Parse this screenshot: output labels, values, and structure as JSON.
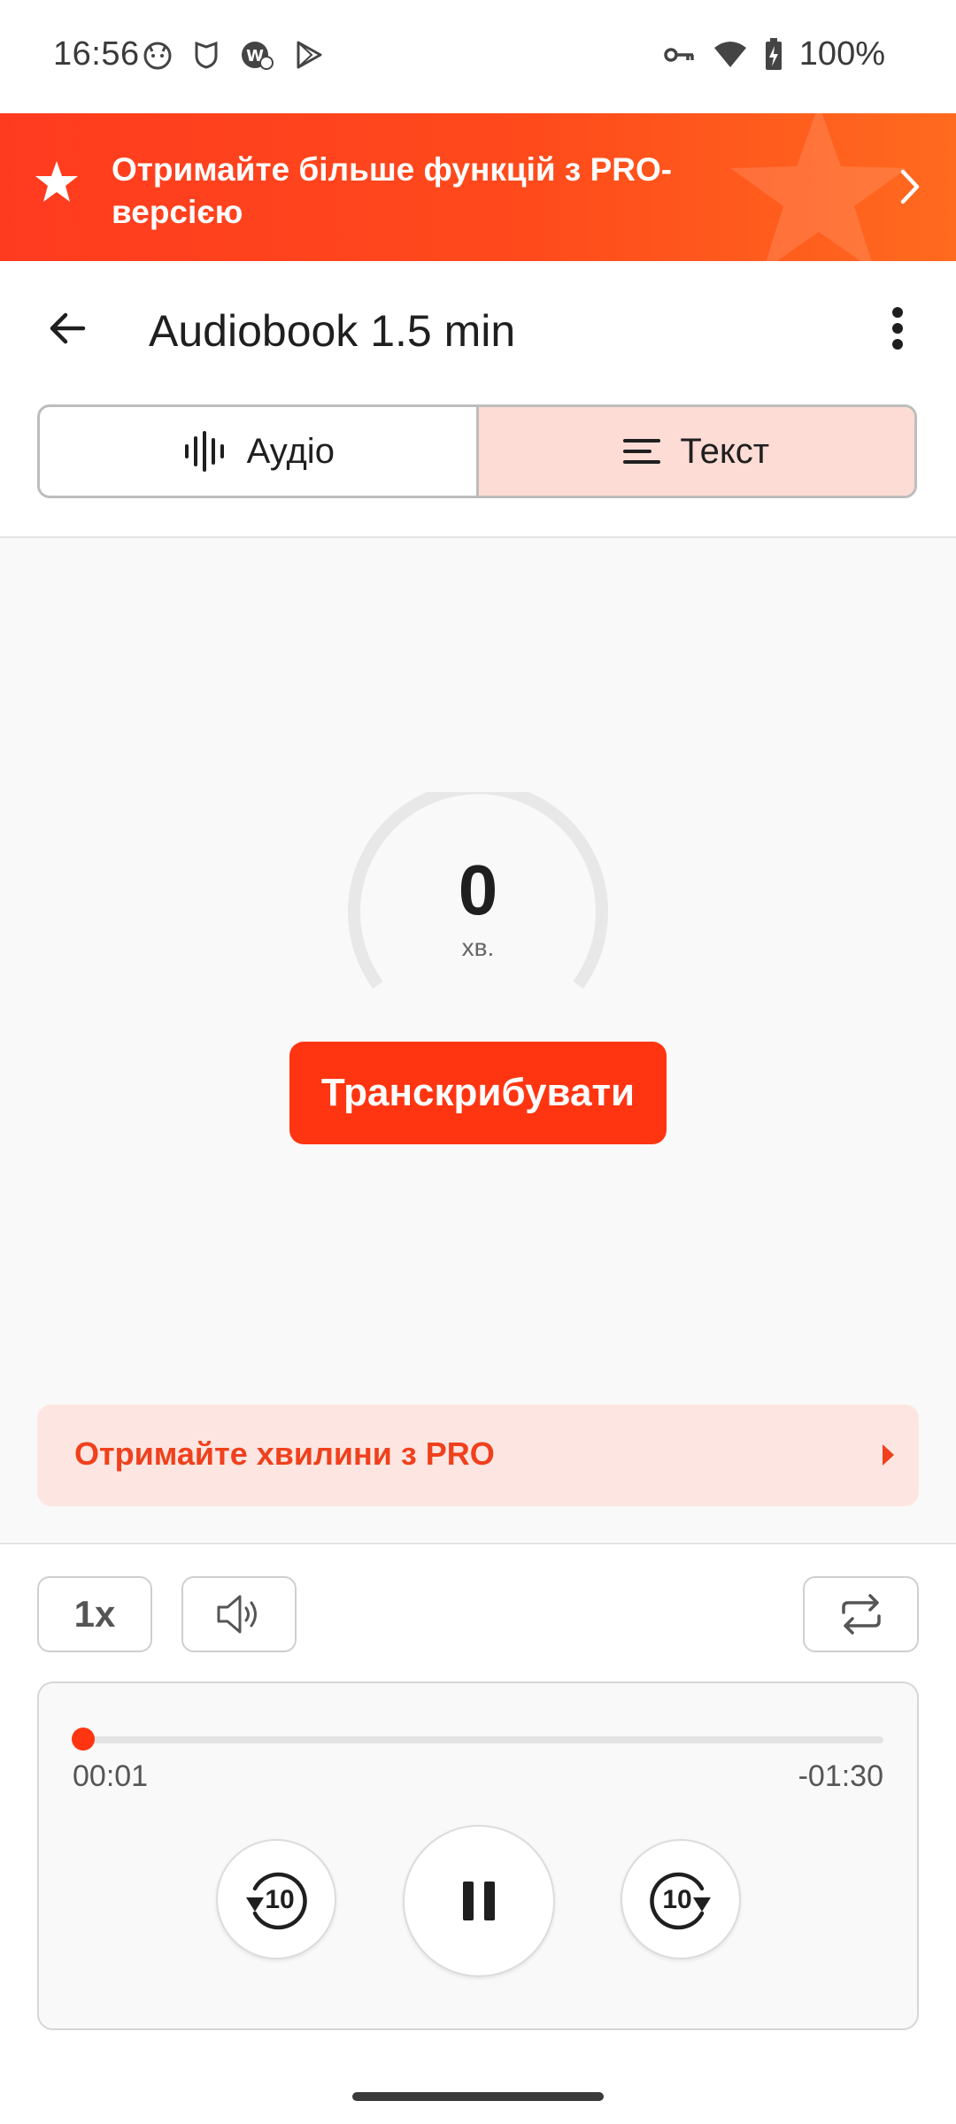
{
  "status_bar": {
    "time": "16:56",
    "battery": "100%",
    "left_icons": [
      "cat-face-icon",
      "shield-icon",
      "wallet-check-icon",
      "play-store-icon"
    ],
    "right_icons": [
      "vpn-key-icon",
      "wifi-icon",
      "battery-charging-icon"
    ]
  },
  "promo_banner": {
    "text": "Отримайте більше функцій з PRO-версією",
    "icon": "star-icon",
    "background": "#ff3b1f"
  },
  "header": {
    "title": "Audiobook 1.5 min",
    "back_icon": "arrow-left-icon",
    "menu_icon": "more-vert-icon"
  },
  "tabs": [
    {
      "label": "Аудіо",
      "icon": "waveform-icon",
      "selected": false
    },
    {
      "label": "Текст",
      "icon": "text-lines-icon",
      "selected": true
    }
  ],
  "transcription": {
    "minutes_value": "0",
    "minutes_unit": "хв.",
    "button_label": "Транскрибувати"
  },
  "pro_minutes": {
    "label": "Отримайте хвилини з PRO"
  },
  "player": {
    "speed_label": "1x",
    "elapsed": "00:01",
    "remaining": "-01:30",
    "progress": 0.011,
    "rewind_label": "10",
    "forward_label": "10",
    "accent": "#ff3512"
  }
}
